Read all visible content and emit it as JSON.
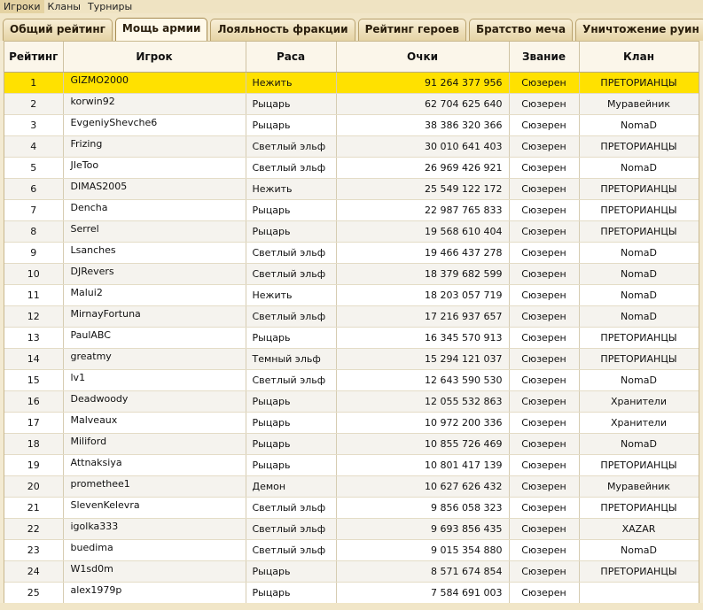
{
  "nav": [
    "Игроки",
    "Кланы",
    "Турниры"
  ],
  "tabs": [
    "Общий рейтинг",
    "Мощь армии",
    "Лояльность фракции",
    "Рейтинг героев",
    "Братство меча",
    "Уничтожение руин"
  ],
  "active_tab": 1,
  "columns": {
    "rank": "Рейтинг",
    "player": "Игрок",
    "race": "Раса",
    "points": "Очки",
    "title": "Звание",
    "clan": "Клан"
  },
  "highlight_color": "#ffe100",
  "rows": [
    {
      "rank": "1",
      "player": "GIZMO2000",
      "race": "Нежить",
      "points": "91 264 377 956",
      "title": "Сюзерен",
      "clan": "ПРЕТОРИАНЦЫ"
    },
    {
      "rank": "2",
      "player": "korwin92",
      "race": "Рыцарь",
      "points": "62 704 625 640",
      "title": "Сюзерен",
      "clan": "Муравейник"
    },
    {
      "rank": "3",
      "player": "EvgeniyShevche6",
      "race": "Рыцарь",
      "points": "38 386 320 366",
      "title": "Сюзерен",
      "clan": "NomaD"
    },
    {
      "rank": "4",
      "player": "Frizing",
      "race": "Светлый эльф",
      "points": "30 010 641 403",
      "title": "Сюзерен",
      "clan": "ПРЕТОРИАНЦЫ"
    },
    {
      "rank": "5",
      "player": "JIeToo",
      "race": "Светлый эльф",
      "points": "26 969 426 921",
      "title": "Сюзерен",
      "clan": "NomaD"
    },
    {
      "rank": "6",
      "player": "DIMAS2005",
      "race": "Нежить",
      "points": "25 549 122 172",
      "title": "Сюзерен",
      "clan": "ПРЕТОРИАНЦЫ"
    },
    {
      "rank": "7",
      "player": "Dencha",
      "race": "Рыцарь",
      "points": "22 987 765 833",
      "title": "Сюзерен",
      "clan": "ПРЕТОРИАНЦЫ"
    },
    {
      "rank": "8",
      "player": "Serrel",
      "race": "Рыцарь",
      "points": "19 568 610 404",
      "title": "Сюзерен",
      "clan": "ПРЕТОРИАНЦЫ"
    },
    {
      "rank": "9",
      "player": "Lsanches",
      "race": "Светлый эльф",
      "points": "19 466 437 278",
      "title": "Сюзерен",
      "clan": "NomaD"
    },
    {
      "rank": "10",
      "player": "DJRevers",
      "race": "Светлый эльф",
      "points": "18 379 682 599",
      "title": "Сюзерен",
      "clan": "NomaD"
    },
    {
      "rank": "11",
      "player": "Malui2",
      "race": "Нежить",
      "points": "18 203 057 719",
      "title": "Сюзерен",
      "clan": "NomaD"
    },
    {
      "rank": "12",
      "player": "MirnayFortuna",
      "race": "Светлый эльф",
      "points": "17 216 937 657",
      "title": "Сюзерен",
      "clan": "NomaD"
    },
    {
      "rank": "13",
      "player": "PaulABC",
      "race": "Рыцарь",
      "points": "16 345 570 913",
      "title": "Сюзерен",
      "clan": "ПРЕТОРИАНЦЫ"
    },
    {
      "rank": "14",
      "player": "greatmy",
      "race": "Темный эльф",
      "points": "15 294 121 037",
      "title": "Сюзерен",
      "clan": "ПРЕТОРИАНЦЫ"
    },
    {
      "rank": "15",
      "player": "lv1",
      "race": "Светлый эльф",
      "points": "12 643 590 530",
      "title": "Сюзерен",
      "clan": "NomaD"
    },
    {
      "rank": "16",
      "player": "Deadwoody",
      "race": "Рыцарь",
      "points": "12 055 532 863",
      "title": "Сюзерен",
      "clan": "Хранители"
    },
    {
      "rank": "17",
      "player": "Malveaux",
      "race": "Рыцарь",
      "points": "10 972 200 336",
      "title": "Сюзерен",
      "clan": "Хранители"
    },
    {
      "rank": "18",
      "player": "Miliford",
      "race": "Рыцарь",
      "points": "10 855 726 469",
      "title": "Сюзерен",
      "clan": "NomaD"
    },
    {
      "rank": "19",
      "player": "Attnaksiya",
      "race": "Рыцарь",
      "points": "10 801 417 139",
      "title": "Сюзерен",
      "clan": "ПРЕТОРИАНЦЫ"
    },
    {
      "rank": "20",
      "player": "promethee1",
      "race": "Демон",
      "points": "10 627 626 432",
      "title": "Сюзерен",
      "clan": "Муравейник"
    },
    {
      "rank": "21",
      "player": "SlevenKelevra",
      "race": "Светлый эльф",
      "points": "9 856 058 323",
      "title": "Сюзерен",
      "clan": "ПРЕТОРИАНЦЫ"
    },
    {
      "rank": "22",
      "player": "igolka333",
      "race": "Светлый эльф",
      "points": "9 693 856 435",
      "title": "Сюзерен",
      "clan": "XAZAR"
    },
    {
      "rank": "23",
      "player": "buedima",
      "race": "Светлый эльф",
      "points": "9 015 354 880",
      "title": "Сюзерен",
      "clan": "NomaD"
    },
    {
      "rank": "24",
      "player": "W1sd0m",
      "race": "Рыцарь",
      "points": "8 571 674 854",
      "title": "Сюзерен",
      "clan": "ПРЕТОРИАНЦЫ"
    },
    {
      "rank": "25",
      "player": "alex1979p",
      "race": "Рыцарь",
      "points": "7 584 691 003",
      "title": "Сюзерен",
      "clan": ""
    }
  ]
}
